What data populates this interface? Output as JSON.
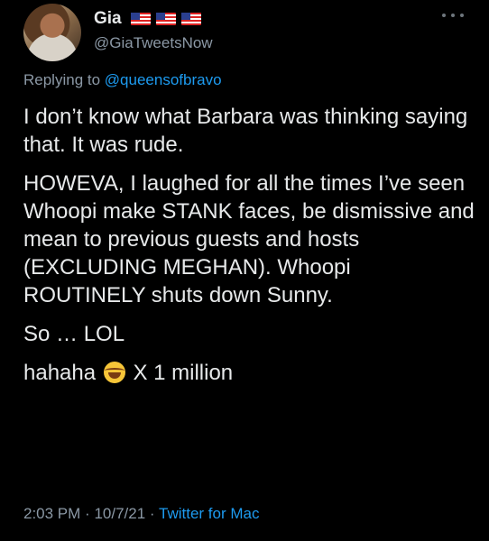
{
  "user": {
    "display_name": "Gia",
    "handle": "@GiaTweetsNow",
    "flag_count": 3,
    "flag_icon": "us-flag-icon"
  },
  "reply": {
    "prefix": "Replying to",
    "mention": "@queensofbravo"
  },
  "tweet": {
    "paragraphs": [
      "I don’t know what Barbara was thinking saying that. It was rude.",
      "HOWEVA, I laughed for all the times I’ve seen Whoopi make STANK faces, be dismissive and mean to previous guests and hosts (EXCLUDING MEGHAN). Whoopi ROUTINELY shuts down Sunny.",
      "So … LOL"
    ],
    "last_line_before_emoji": "hahaha",
    "emoji": "joy-emoji-icon",
    "last_line_after_emoji": "X 1 million"
  },
  "meta": {
    "time": "2:03 PM",
    "date": "10/7/21",
    "separator": "·",
    "source": "Twitter for Mac"
  },
  "colors": {
    "background": "#000000",
    "text": "#e7e9ea",
    "secondary": "#8b98a5",
    "accent": "#1d9bf0"
  }
}
